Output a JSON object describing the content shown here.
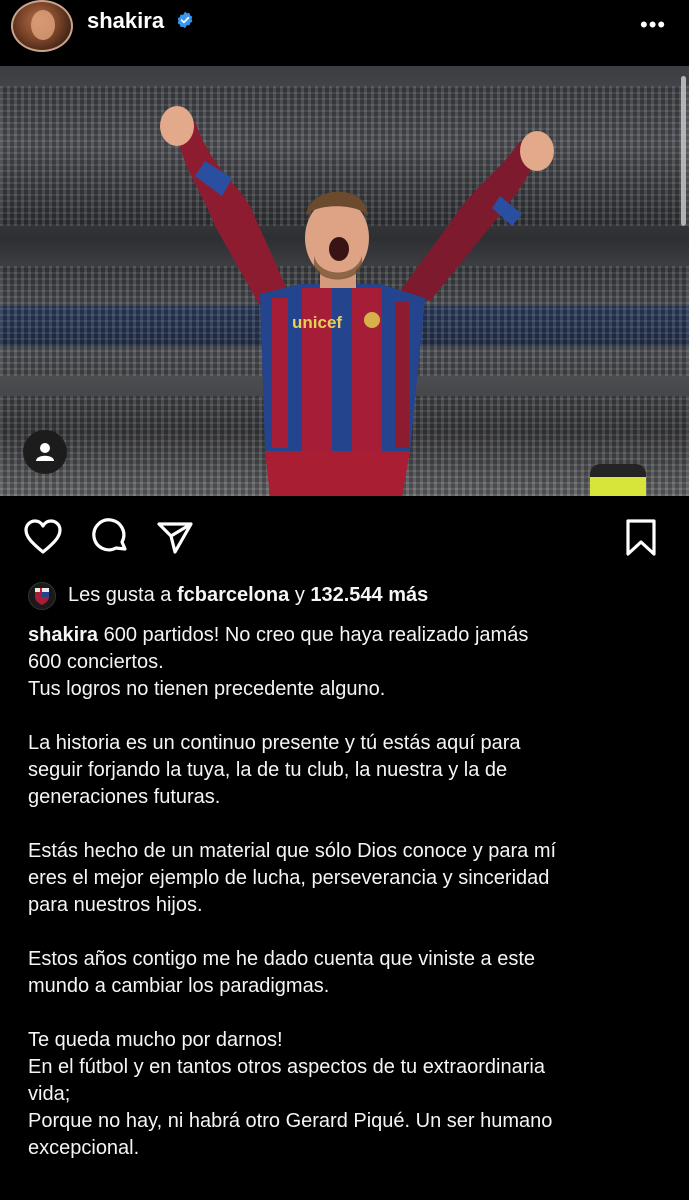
{
  "post": {
    "username": "shakira",
    "verified_icon": "verified-badge-icon",
    "more_label": "•••",
    "likes_prefix": "Les gusta a",
    "likes_account": "fcbarcelona",
    "likes_connector": "y",
    "likes_count": "132.544 más"
  },
  "caption": {
    "username": "shakira",
    "lines": [
      "600 partidos! No creo que haya realizado jamás",
      "600 conciertos.",
      "Tus logros no tienen precedente alguno.",
      "",
      "La historia es un continuo presente y tú estás aquí para",
      "seguir forjando la tuya, la de tu club, la nuestra y la de",
      "generaciones futuras.",
      "",
      "Estás hecho de un material que sólo Dios conoce y para mí",
      "eres el mejor ejemplo de lucha, perseverancia y sinceridad",
      "para nuestros hijos.",
      "",
      "Estos años contigo me he dado cuenta que viniste a este",
      "mundo a cambiar los paradigmas.",
      "",
      "Te queda mucho por darnos!",
      "En el fútbol y en tantos otros aspectos de tu extraordinaria",
      "vida;",
      "Porque no hay, ni habrá otro Gerard Piqué. Un ser humano",
      "excepcional."
    ]
  },
  "colors": {
    "background": "#000000",
    "text": "#f5f5f5",
    "verified": "#3897f0",
    "jersey_red": "#a51d36",
    "jersey_blue": "#23448c"
  },
  "icons": [
    "heart-icon",
    "comment-icon",
    "share-icon",
    "bookmark-icon",
    "person-tag-icon"
  ]
}
